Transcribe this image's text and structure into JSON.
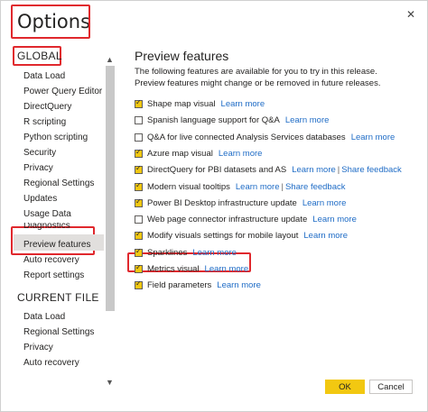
{
  "window": {
    "title": "Options",
    "close_glyph": "✕"
  },
  "sidebar": {
    "global_header": "GLOBAL",
    "global_items": [
      "Data Load",
      "Power Query Editor",
      "DirectQuery",
      "R scripting",
      "Python scripting",
      "Security",
      "Privacy",
      "Regional Settings",
      "Updates",
      "Usage Data",
      "Diagnostics",
      "Preview features",
      "Auto recovery",
      "Report settings"
    ],
    "current_file_header": "CURRENT FILE",
    "current_file_items": [
      "Data Load",
      "Regional Settings",
      "Privacy",
      "Auto recovery"
    ],
    "selected_item": "Preview features",
    "scroll_up_icon": "chevron-up-icon",
    "scroll_down_icon": "chevron-down-icon"
  },
  "main": {
    "title": "Preview features",
    "description": "The following features are available for you to try in this release. Preview features might change or be removed in future releases.",
    "features": [
      {
        "label": "Shape map visual",
        "checked": true,
        "links": [
          "Learn more"
        ]
      },
      {
        "label": "Spanish language support for Q&A",
        "checked": false,
        "links": [
          "Learn more"
        ]
      },
      {
        "label": "Q&A for live connected Analysis Services databases",
        "checked": false,
        "links": [
          "Learn more"
        ]
      },
      {
        "label": "Azure map visual",
        "checked": true,
        "links": [
          "Learn more"
        ]
      },
      {
        "label": "DirectQuery for PBI datasets and AS",
        "checked": true,
        "links": [
          "Learn more",
          "Share feedback"
        ]
      },
      {
        "label": "Modern visual tooltips",
        "checked": true,
        "links": [
          "Learn more",
          "Share feedback"
        ]
      },
      {
        "label": "Power BI Desktop infrastructure update",
        "checked": true,
        "links": [
          "Learn more"
        ]
      },
      {
        "label": "Web page connector infrastructure update",
        "checked": false,
        "links": [
          "Learn more"
        ]
      },
      {
        "label": "Modify visuals settings for mobile layout",
        "checked": true,
        "links": [
          "Learn more"
        ]
      },
      {
        "label": "Sparklines",
        "checked": true,
        "links": [
          "Learn more"
        ]
      },
      {
        "label": "Metrics visual",
        "checked": true,
        "links": [
          "Learn more"
        ]
      },
      {
        "label": "Field parameters",
        "checked": true,
        "links": [
          "Learn more"
        ]
      }
    ]
  },
  "buttons": {
    "ok": "OK",
    "cancel": "Cancel"
  },
  "colors": {
    "accent": "#f2c811",
    "link": "#1f6cc6",
    "highlight": "#e0282d",
    "selected_bg": "#e1dfdd"
  }
}
